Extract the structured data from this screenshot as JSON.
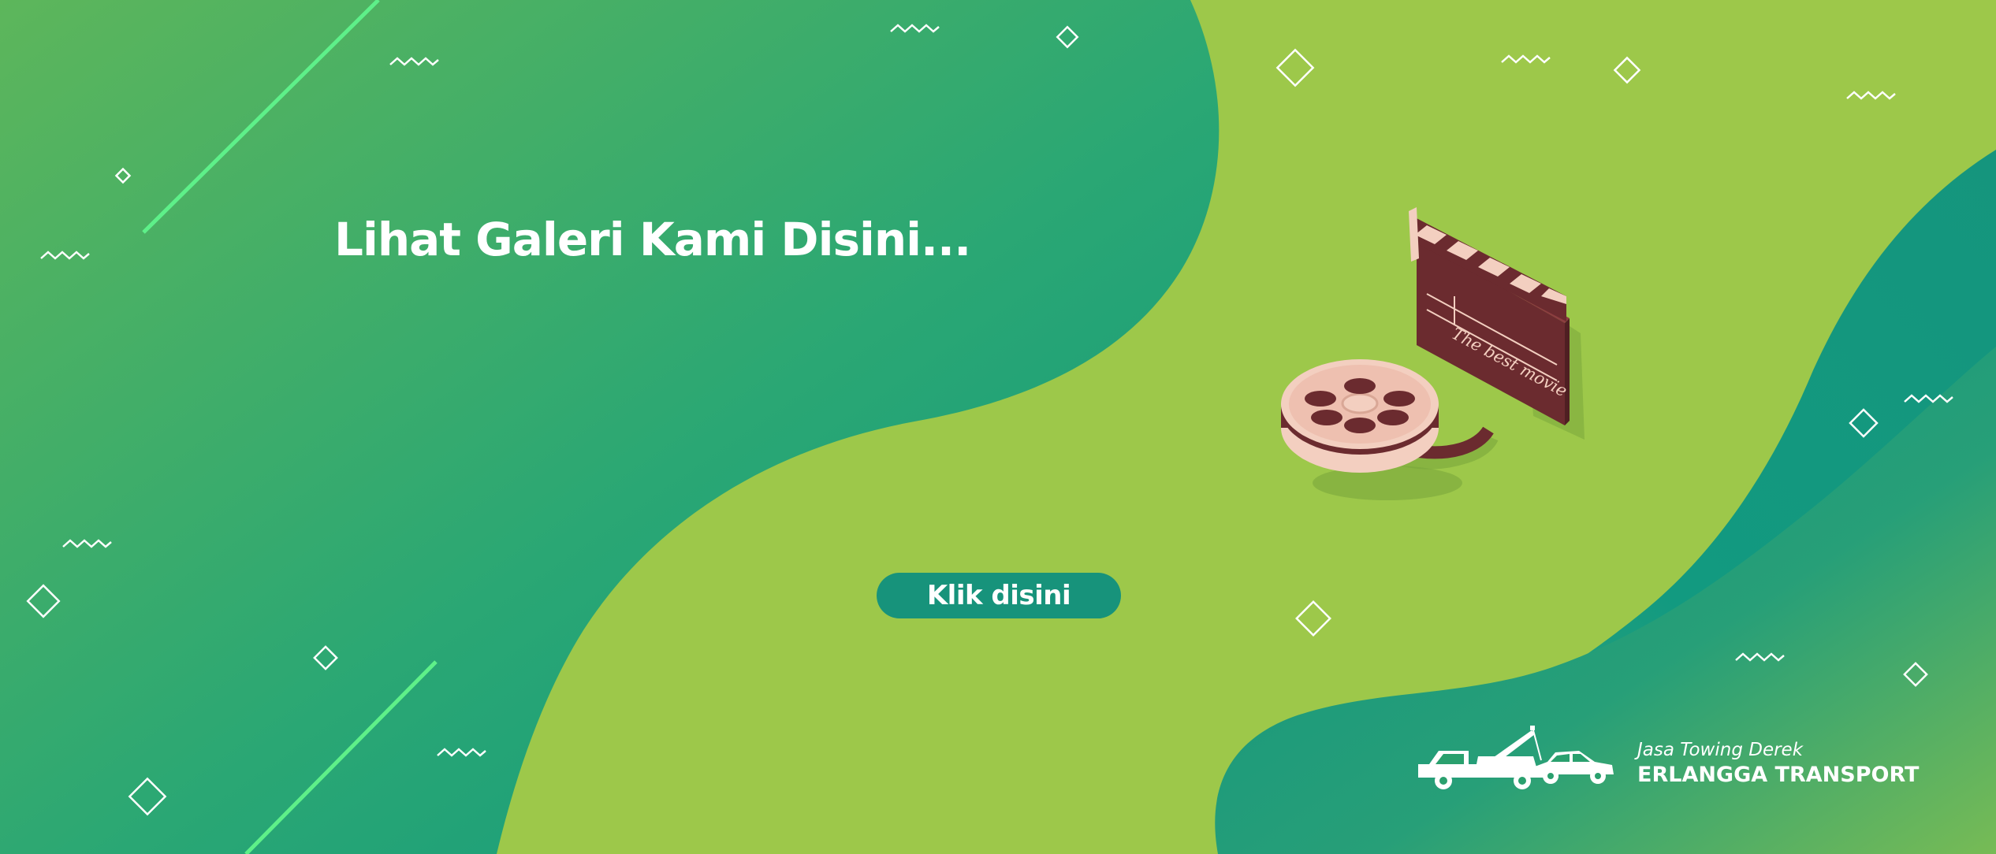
{
  "hero": {
    "headline": "Lihat Galeri Kami Disini...",
    "cta_label": "Klik disini"
  },
  "illustration": {
    "clapper_text": "The best movie",
    "icons": [
      "clapperboard-icon",
      "film-reel-icon"
    ]
  },
  "brand": {
    "tagline": "Jasa Towing Derek",
    "name": "ERLANGGA TRANSPORT",
    "logo_icon": "tow-truck-icon"
  },
  "colors": {
    "background_light": "#9dc84a",
    "green_dark": "#17937b",
    "green_mid": "#3dab6a",
    "accent_line": "#5ef089",
    "text": "#ffffff",
    "clapper_brown": "#6b2b2f",
    "reel_pink": "#f3cfc0"
  }
}
